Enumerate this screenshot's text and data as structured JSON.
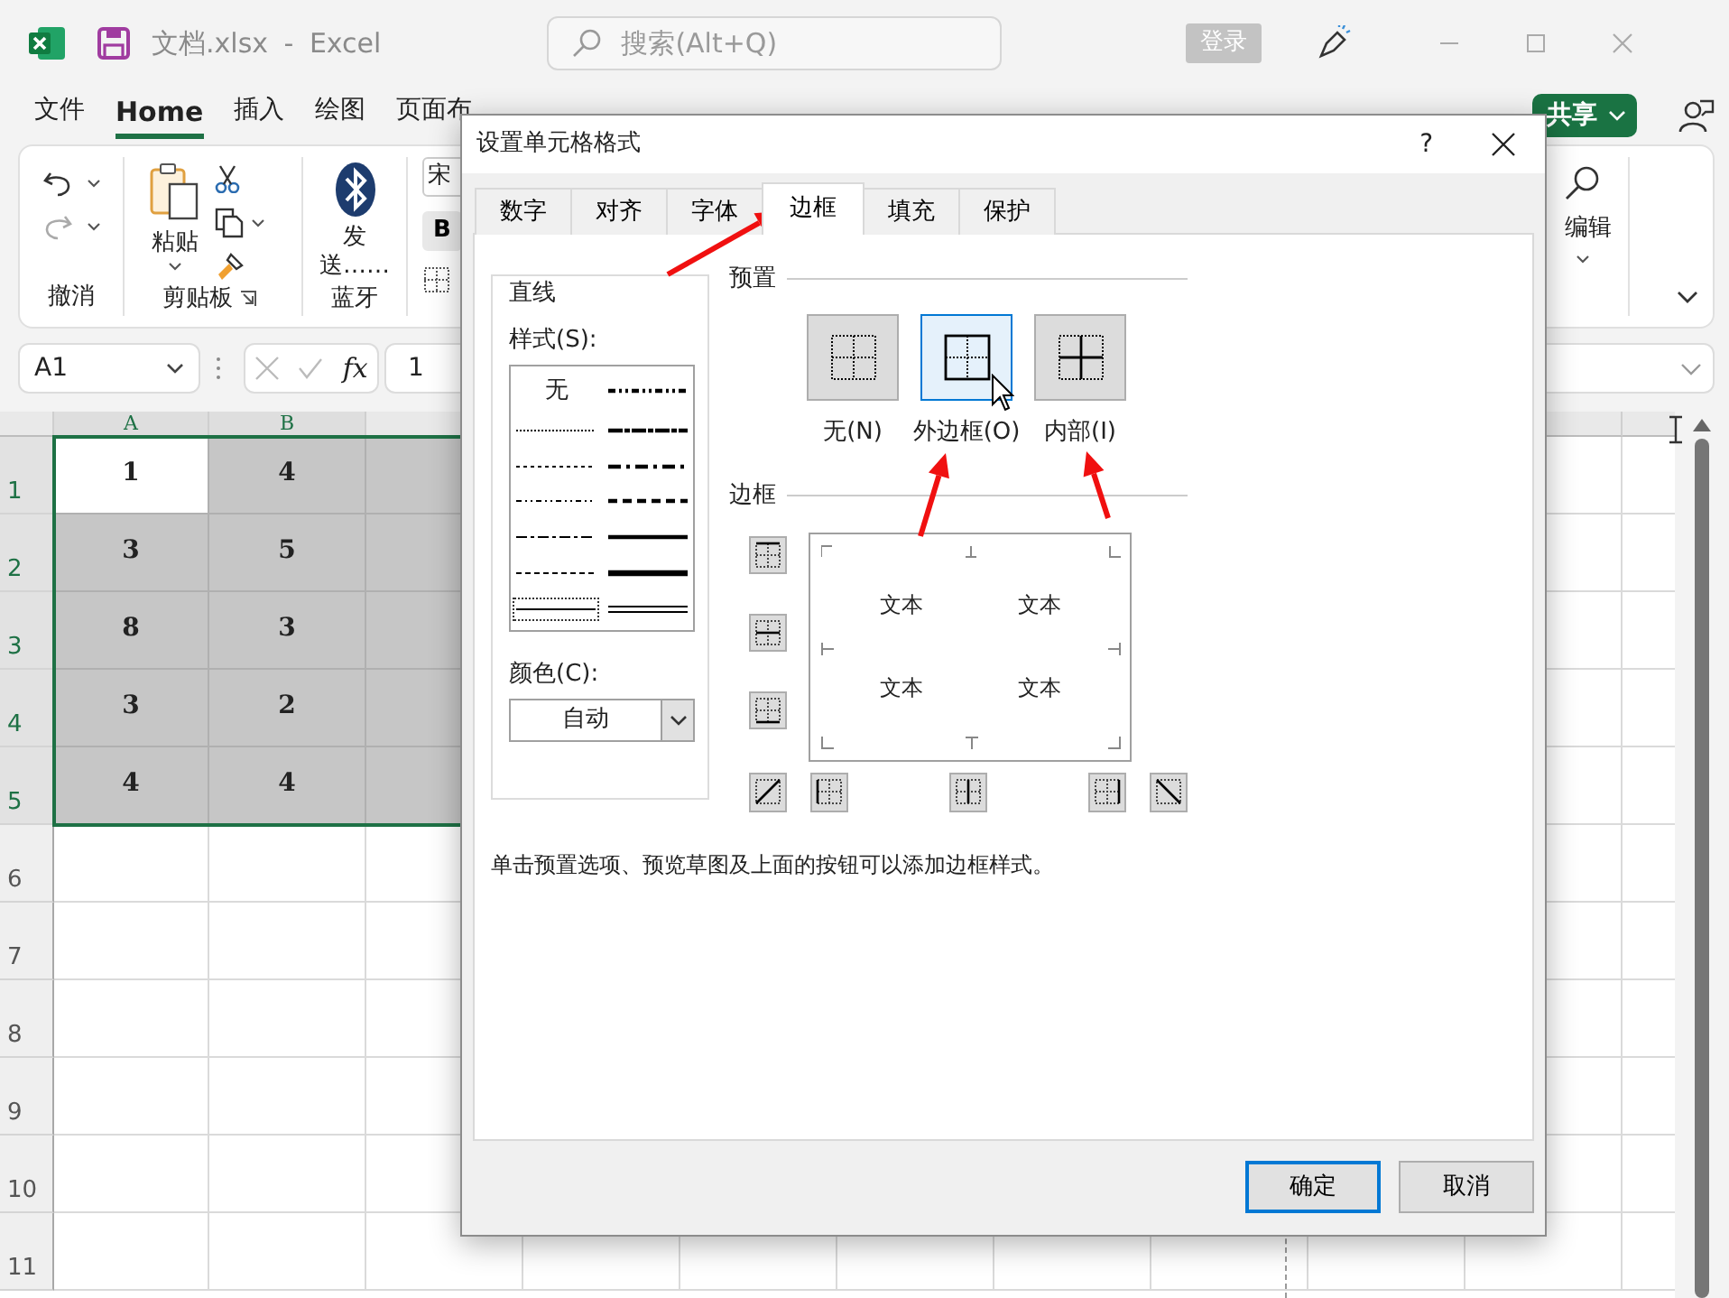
{
  "window": {
    "title": "文档.xlsx - Excel",
    "search": {
      "placeholder": "搜索(Alt+Q)"
    },
    "sign_in": "登录"
  },
  "menu_tabs": [
    {
      "label": "文件",
      "selected": false
    },
    {
      "label": "Home",
      "selected": true
    },
    {
      "label": "插入",
      "selected": false
    },
    {
      "label": "绘图",
      "selected": false
    },
    {
      "label": "页面布",
      "selected": false
    }
  ],
  "share_button": "共享",
  "ribbon": {
    "groups": [
      {
        "kind": "undo",
        "label": "撤消"
      },
      {
        "kind": "clipboard",
        "label": "剪贴板",
        "button": "粘贴"
      },
      {
        "kind": "bluetooth",
        "label": "蓝牙",
        "button": "发送……"
      },
      {
        "kind": "font",
        "font_name": "宋",
        "bold": "B"
      },
      {
        "kind": "editing",
        "button": "编辑"
      }
    ]
  },
  "formula_bar": {
    "name_box": "A1",
    "fx": "fx",
    "value": "1"
  },
  "sheet": {
    "columns": [
      {
        "label": "A",
        "selected": true
      },
      {
        "label": "B",
        "selected": true
      }
    ],
    "rows": [
      {
        "header": "1",
        "selected": true,
        "cells": [
          {
            "value": "1",
            "active": true
          },
          {
            "value": "4",
            "active": false
          },
          {
            "active": false
          }
        ]
      },
      {
        "header": "2",
        "selected": true,
        "cells": [
          {
            "value": "3",
            "active": false
          },
          {
            "value": "5",
            "active": false
          },
          {
            "active": false
          }
        ]
      },
      {
        "header": "3",
        "selected": true,
        "cells": [
          {
            "value": "8",
            "active": false
          },
          {
            "value": "3",
            "active": false
          },
          {
            "active": false
          }
        ]
      },
      {
        "header": "4",
        "selected": true,
        "cells": [
          {
            "value": "3",
            "active": false
          },
          {
            "value": "2",
            "active": false
          },
          {
            "active": false
          }
        ]
      },
      {
        "header": "5",
        "selected": true,
        "cells": [
          {
            "value": "4",
            "active": false
          },
          {
            "value": "4",
            "active": false
          },
          {
            "active": false
          }
        ]
      },
      {
        "header": "6",
        "selected": false
      },
      {
        "header": "7",
        "selected": false
      },
      {
        "header": "8",
        "selected": false
      },
      {
        "header": "9",
        "selected": false
      },
      {
        "header": "10",
        "selected": false
      },
      {
        "header": "11",
        "selected": false
      }
    ]
  },
  "dialog": {
    "title": "设置单元格格式",
    "help": "?",
    "tabs": [
      {
        "label": "数字",
        "selected": false
      },
      {
        "label": "对齐",
        "selected": false
      },
      {
        "label": "字体",
        "selected": false
      },
      {
        "label": "边框",
        "selected": true
      },
      {
        "label": "填充",
        "selected": false
      },
      {
        "label": "保护",
        "selected": false
      }
    ],
    "line": {
      "title": "直线",
      "style_label": "样式(S):",
      "styles": [
        {
          "kind": "none",
          "label": "无",
          "selected": false
        },
        {
          "kind": "hair",
          "selected": false
        },
        {
          "kind": "dotted",
          "selected": false
        },
        {
          "kind": "dash_dot_dot",
          "selected": false
        },
        {
          "kind": "dash_dot",
          "selected": false
        },
        {
          "kind": "dashed",
          "selected": false
        },
        {
          "kind": "thin",
          "selected": true
        },
        {
          "kind": "medium_dash_dot_dot",
          "selected": false
        },
        {
          "kind": "slant_dash_dot",
          "selected": false
        },
        {
          "kind": "medium_dash_dot",
          "selected": false
        },
        {
          "kind": "medium_dashed",
          "selected": false
        },
        {
          "kind": "medium",
          "selected": false
        },
        {
          "kind": "thick",
          "selected": false
        },
        {
          "kind": "double",
          "selected": false
        }
      ],
      "color_label": "颜色(C):",
      "color_value": "自动"
    },
    "presets": {
      "title": "预置",
      "items": [
        {
          "kind": "none",
          "label": "无(N)",
          "selected": false
        },
        {
          "kind": "outline",
          "label": "外边框(O)",
          "selected": true
        },
        {
          "kind": "inside",
          "label": "内部(I)",
          "selected": false
        }
      ]
    },
    "border": {
      "title": "边框",
      "preview_texts": [
        "文本",
        "文本",
        "文本",
        "文本"
      ],
      "side_buttons": [
        {
          "kind": "top"
        },
        {
          "kind": "middle_h"
        },
        {
          "kind": "bottom"
        }
      ],
      "bottom_buttons": [
        {
          "kind": "diag_up"
        },
        {
          "kind": "left"
        },
        {
          "kind": "center_v"
        },
        {
          "kind": "right"
        },
        {
          "kind": "diag_down"
        }
      ]
    },
    "hint": "单击预置选项、预览草图及上面的按钮可以添加边框样式。",
    "buttons": [
      {
        "label": "确定",
        "default": true
      },
      {
        "label": "取消",
        "default": false
      }
    ]
  }
}
